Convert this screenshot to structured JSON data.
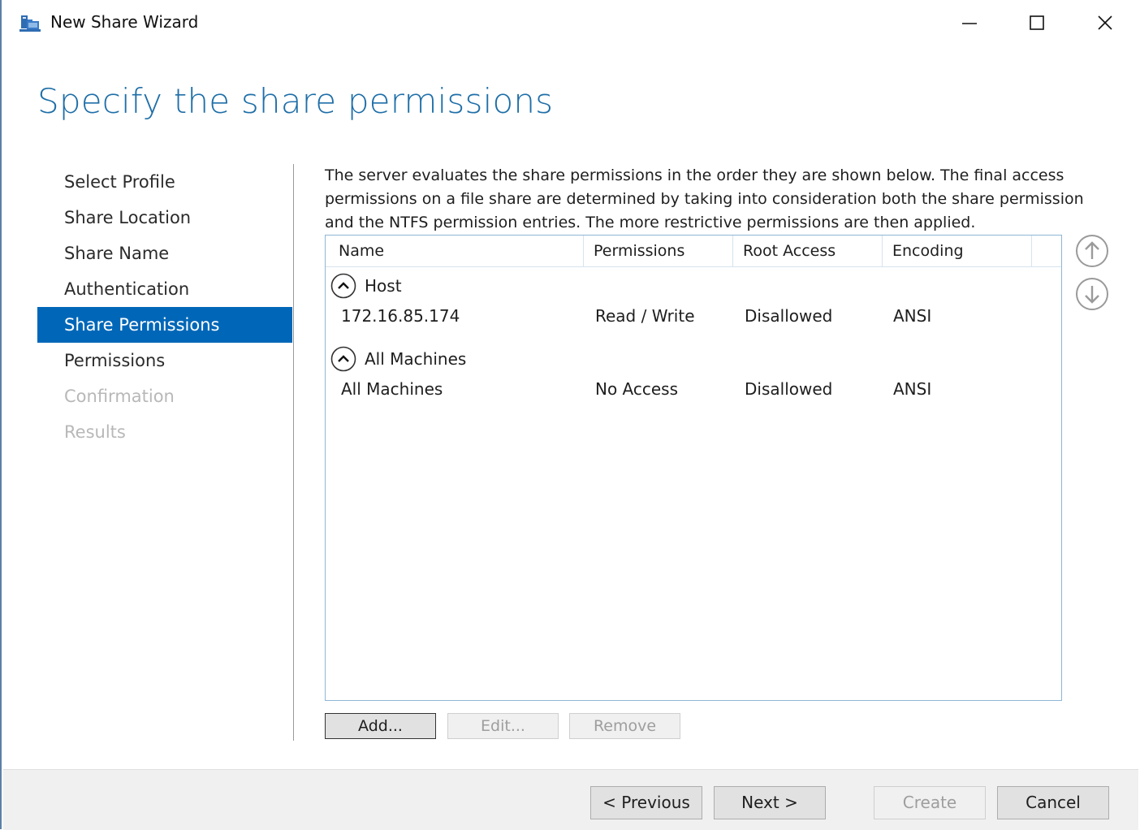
{
  "window": {
    "title": "New Share Wizard",
    "icons": {
      "app": "share-folder-icon",
      "minimize": "minimize-icon",
      "maximize": "maximize-icon",
      "close": "close-icon"
    }
  },
  "page": {
    "title": "Specify the share permissions",
    "description": "The server evaluates the share permissions in the order they are shown below. The final access permissions on a file share are determined by taking into consideration both the share permission and the NTFS permission entries. The more restrictive permissions are then applied."
  },
  "nav": {
    "items": [
      {
        "label": "Select Profile",
        "state": "normal"
      },
      {
        "label": "Share Location",
        "state": "normal"
      },
      {
        "label": "Share Name",
        "state": "normal"
      },
      {
        "label": "Authentication",
        "state": "normal"
      },
      {
        "label": "Share Permissions",
        "state": "active"
      },
      {
        "label": "Permissions",
        "state": "normal"
      },
      {
        "label": "Confirmation",
        "state": "disabled"
      },
      {
        "label": "Results",
        "state": "disabled"
      }
    ]
  },
  "table": {
    "columns": [
      "Name",
      "Permissions",
      "Root Access",
      "Encoding"
    ],
    "groups": [
      {
        "label": "Host",
        "rows": [
          {
            "name": "172.16.85.174",
            "permissions": "Read / Write",
            "root_access": "Disallowed",
            "encoding": "ANSI"
          }
        ]
      },
      {
        "label": "All Machines",
        "rows": [
          {
            "name": "All Machines",
            "permissions": "No Access",
            "root_access": "Disallowed",
            "encoding": "ANSI"
          }
        ]
      }
    ],
    "move_up_icon": "arrow-up-circle-icon",
    "move_down_icon": "arrow-down-circle-icon"
  },
  "actions": {
    "add": "Add...",
    "edit": "Edit...",
    "remove": "Remove"
  },
  "footer": {
    "previous": "< Previous",
    "next": "Next >",
    "create": "Create",
    "cancel": "Cancel"
  },
  "colors": {
    "accent": "#0067b8",
    "title": "#1f6fa8",
    "disabled_text": "#b8b8b8"
  }
}
